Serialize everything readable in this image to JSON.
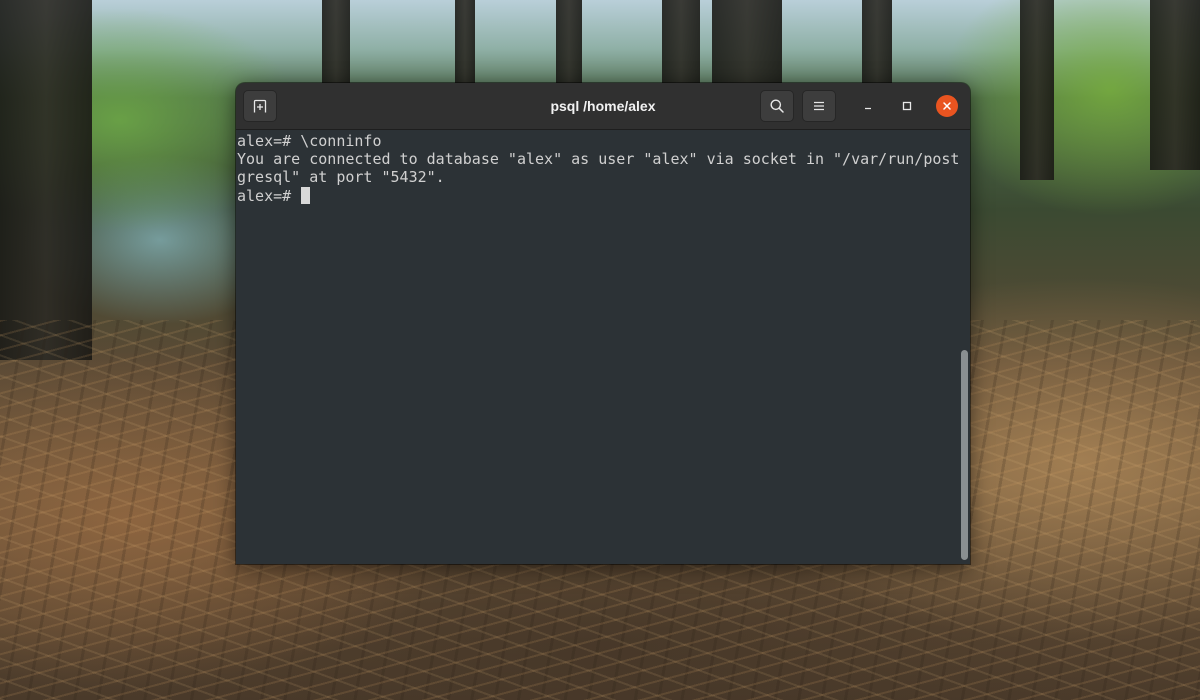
{
  "window": {
    "title": "psql /home/alex"
  },
  "headerbar": {
    "new_tab_icon": "new-tab-icon",
    "search_icon": "search-icon",
    "menu_icon": "hamburger-menu-icon",
    "minimize_icon": "minimize-icon",
    "maximize_icon": "maximize-icon",
    "close_icon": "close-icon",
    "close_color": "#e95420"
  },
  "terminal": {
    "lines": [
      "alex=# \\conninfo",
      "You are connected to database \"alex\" as user \"alex\" via socket in \"/var/run/post",
      "gresql\" at port \"5432\"."
    ],
    "prompt": "alex=# "
  },
  "colors": {
    "terminal_bg": "#2c3236",
    "headerbar_bg": "#303030",
    "text": "#d0d0d0",
    "accent": "#e95420"
  }
}
